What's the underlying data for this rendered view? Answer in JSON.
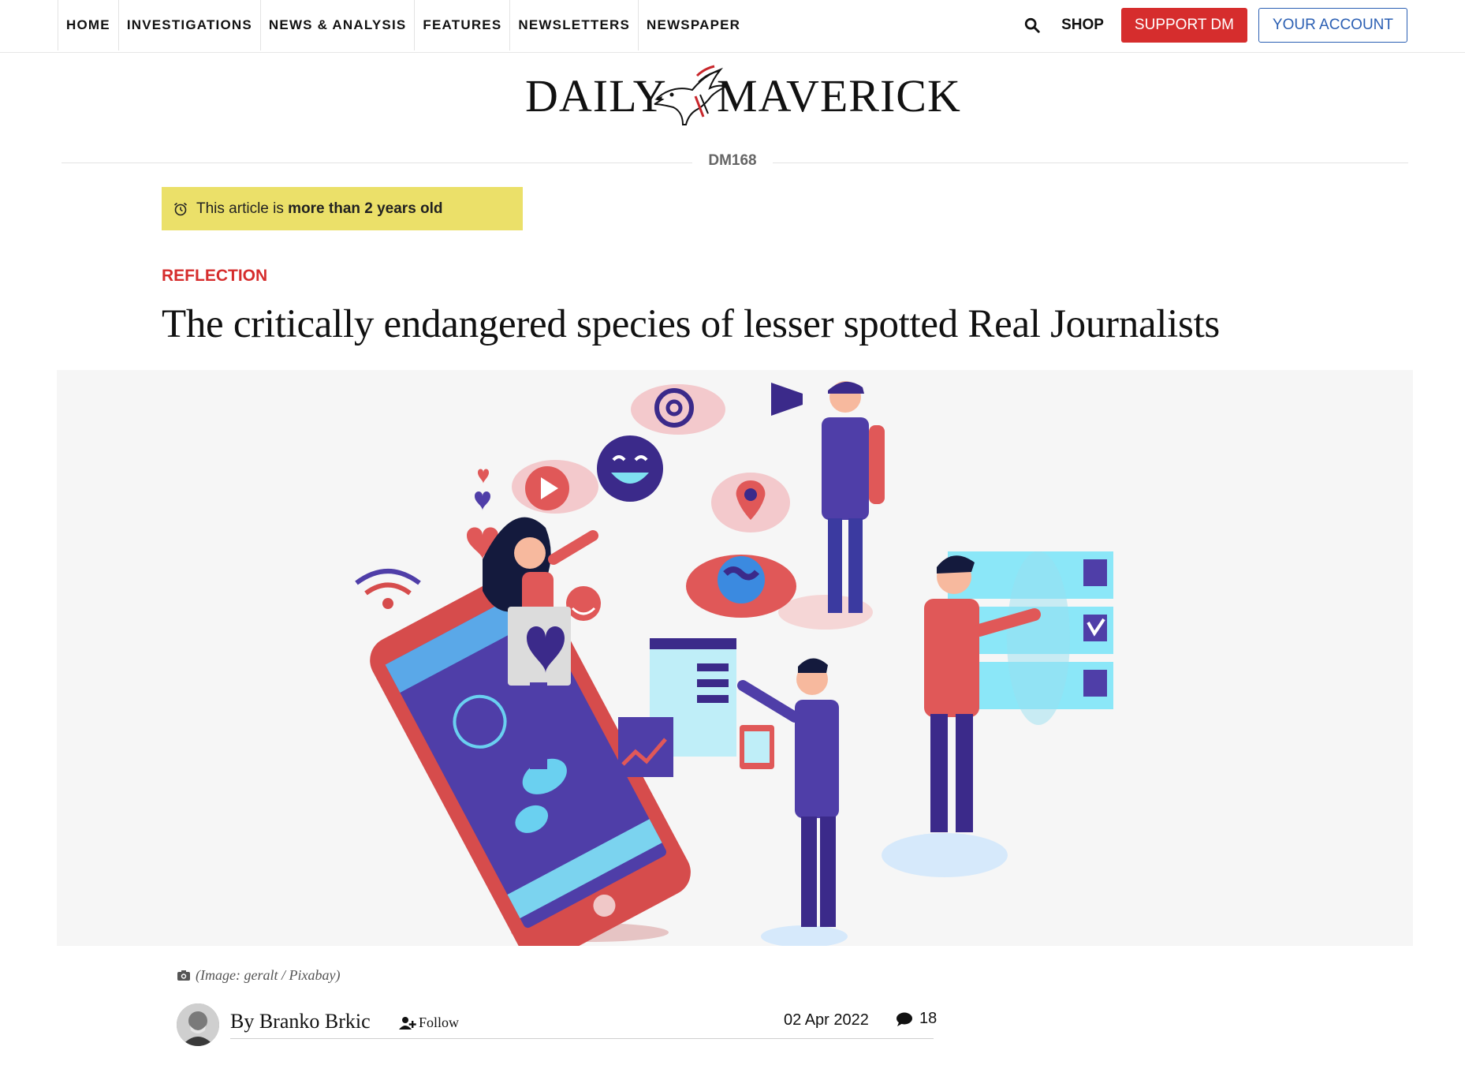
{
  "nav": {
    "items": [
      {
        "label": "HOME"
      },
      {
        "label": "INVESTIGATIONS"
      },
      {
        "label": "NEWS & ANALYSIS"
      },
      {
        "label": "FEATURES"
      },
      {
        "label": "NEWSLETTERS"
      },
      {
        "label": "NEWSPAPER"
      }
    ],
    "search_icon": "search-icon",
    "shop_label": "SHOP",
    "support_label": "SUPPORT DM",
    "account_label": "YOUR ACCOUNT"
  },
  "logo": {
    "left": "DAILY",
    "right": "MAVERICK"
  },
  "section_tag": "DM168",
  "age_notice": {
    "prefix": "This article is",
    "emphasis": "more than 2 years old",
    "icon": "alarm-clock-icon"
  },
  "article": {
    "category": "REFLECTION",
    "headline": "The critically endangered species of lesser spotted Real Journalists",
    "image_caption": "(Image: geralt / Pixabay)",
    "byline_prefix": "By",
    "author": "Branko Brkic",
    "follow_label": "Follow",
    "date": "02 Apr 2022",
    "comment_count": "18"
  },
  "colors": {
    "support_red": "#d62d2d",
    "account_blue": "#2b5fb3",
    "notice_yellow": "#ebe069",
    "category_red": "#d62d2d"
  }
}
